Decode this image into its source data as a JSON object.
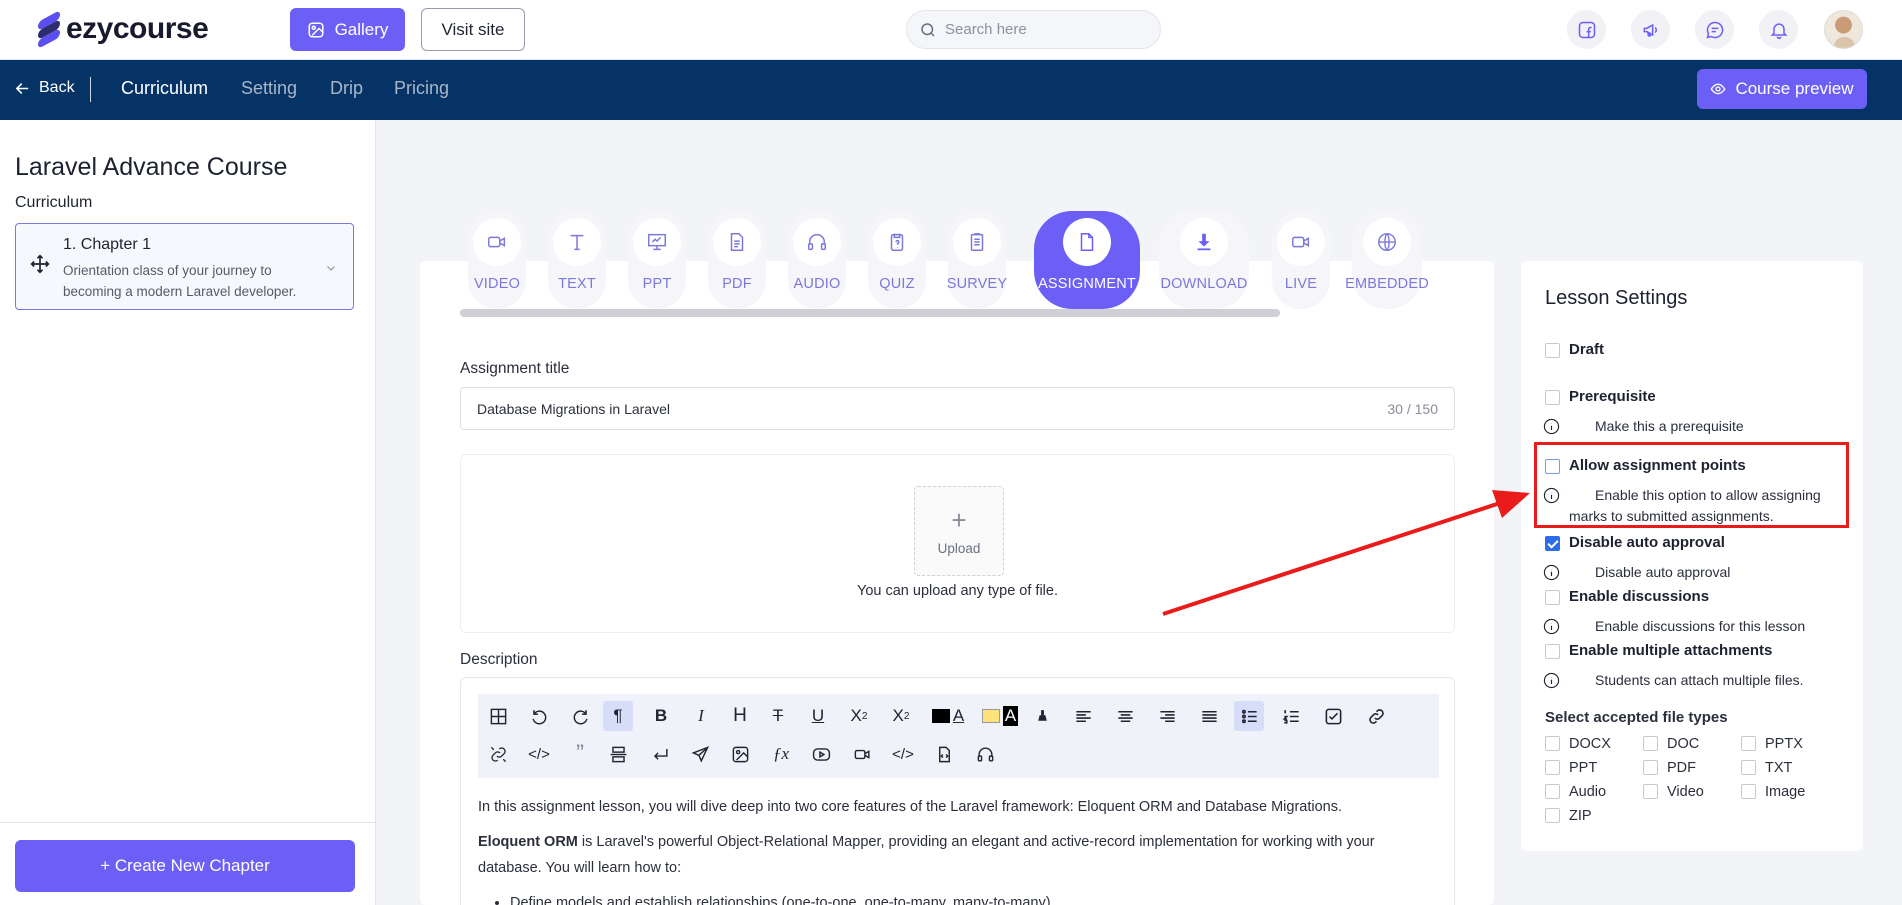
{
  "app": {
    "logo_text": "ezycourse"
  },
  "topbar": {
    "gallery_label": "Gallery",
    "visit_site_label": "Visit site",
    "search_placeholder": "Search here",
    "icons": [
      "facebook-icon",
      "megaphone-icon",
      "chat-icon",
      "bell-icon"
    ]
  },
  "nav": {
    "back_label": "Back",
    "tabs": [
      "Curriculum",
      "Setting",
      "Drip",
      "Pricing"
    ],
    "active_tab": "Curriculum",
    "preview_label": "Course preview"
  },
  "sidebar": {
    "course_title": "Laravel Advance Course",
    "section_label": "Curriculum",
    "chapter": {
      "title": "1. Chapter 1",
      "description": "Orientation class of your journey to becoming a modern Laravel developer."
    },
    "create_label": "+ Create New Chapter"
  },
  "lesson_types": [
    {
      "label": "VIDEO",
      "icon": "video-icon"
    },
    {
      "label": "TEXT",
      "icon": "text-icon"
    },
    {
      "label": "PPT",
      "icon": "presentation-icon"
    },
    {
      "label": "PDF",
      "icon": "document-icon"
    },
    {
      "label": "AUDIO",
      "icon": "headphones-icon"
    },
    {
      "label": "QUIZ",
      "icon": "clipboard-icon"
    },
    {
      "label": "SURVEY",
      "icon": "survey-icon"
    },
    {
      "label": "ASSIGNMENT",
      "icon": "file-icon"
    },
    {
      "label": "DOWNLOAD",
      "icon": "download-icon"
    },
    {
      "label": "LIVE",
      "icon": "live-camera-icon"
    },
    {
      "label": "EMBEDDED",
      "icon": "globe-icon"
    }
  ],
  "active_type": "ASSIGNMENT",
  "assignment": {
    "title_label": "Assignment title",
    "title_value": "Database Migrations in Laravel",
    "title_counter": "30 / 150",
    "upload_label": "Upload",
    "upload_hint": "You can upload any type of file.",
    "description_label": "Description",
    "body": {
      "p1": "In this assignment lesson, you will dive deep into two core features of the Laravel framework: Eloquent ORM and Database Migrations.",
      "p2_bold": "Eloquent ORM",
      "p2_rest": " is Laravel's powerful Object-Relational Mapper, providing an elegant and active-record implementation for working with your database. You will learn how to:",
      "li1": "Define models and establish relationships (one-to-one, one-to-many, many-to-many)."
    }
  },
  "settings": {
    "heading": "Lesson Settings",
    "options": [
      {
        "name": "Draft",
        "checked": false,
        "hint": ""
      },
      {
        "name": "Prerequisite",
        "checked": false,
        "hint": "Make this a prerequisite"
      },
      {
        "name": "Allow assignment points",
        "checked": false,
        "hint": "Enable this option to allow assigning marks to submitted assignments."
      },
      {
        "name": "Disable auto approval",
        "checked": true,
        "hint": "Disable auto approval"
      },
      {
        "name": "Enable discussions",
        "checked": false,
        "hint": "Enable discussions for this lesson"
      },
      {
        "name": "Enable multiple attachments",
        "checked": false,
        "hint": "Students can attach multiple files."
      }
    ],
    "file_types_label": "Select accepted file types",
    "file_types": [
      "DOCX",
      "DOC",
      "PPTX",
      "PPT",
      "PDF",
      "TXT",
      "Audio",
      "Video",
      "Image",
      "ZIP"
    ]
  },
  "colors": {
    "accent": "#6c5ff5",
    "navy": "#063366",
    "annotation_red": "#ea1b1b"
  }
}
